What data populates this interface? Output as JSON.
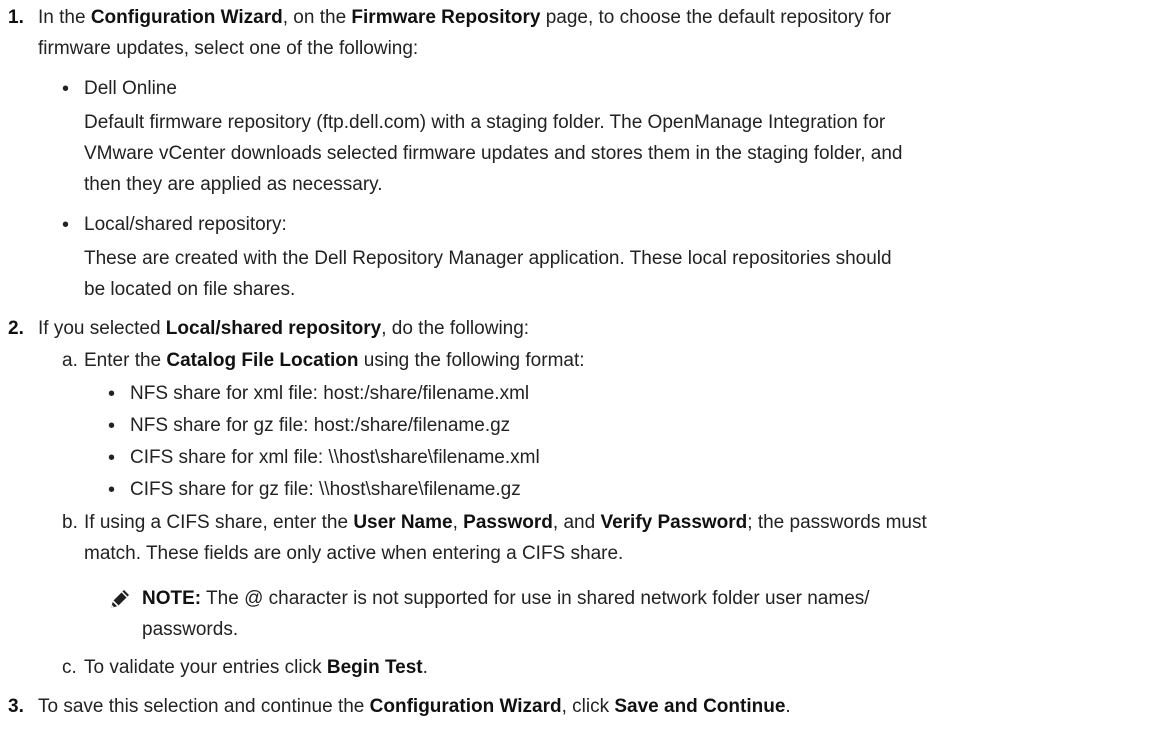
{
  "steps": [
    {
      "number": "1.",
      "text": {
        "p1": "In the ",
        "b1": "Configuration Wizard",
        "p2": ", on the ",
        "b2": "Firmware Repository",
        "p3": " page, to choose the default repository for",
        "line2": "firmware updates, select one of the following:"
      },
      "options": [
        {
          "bullet": "•",
          "title": "Dell Online",
          "desc_lines": [
            "Default firmware repository (ftp.dell.com) with a staging folder. The OpenManage Integration for",
            "VMware vCenter downloads selected firmware updates and stores them in the staging folder, and",
            "then they are applied as necessary."
          ]
        },
        {
          "bullet": "•",
          "title": "Local/shared repository:",
          "desc_lines": [
            "These are created with the Dell Repository Manager application. These local repositories should",
            "be located on file shares."
          ]
        }
      ]
    },
    {
      "number": "2.",
      "text": {
        "p1": "If you selected ",
        "b1": "Local/shared repository",
        "p2": ", do the following:"
      },
      "substeps": {
        "a": {
          "label": "a.",
          "p1": "Enter the ",
          "b1": "Catalog File Location",
          "p2": " using the following format:",
          "bullet": "•",
          "formats": [
            "NFS share for xml file: host:/share/filename.xml",
            "NFS share for gz file: host:/share/filename.gz",
            "CIFS share for xml file: \\\\host\\share\\filename.xml",
            "CIFS share for gz file: \\\\host\\share\\filename.gz"
          ]
        },
        "b": {
          "label": "b.",
          "p1": "If using a CIFS share, enter the ",
          "b1": "User Name",
          "p2": ", ",
          "b2": "Password",
          "p3": ", and ",
          "b3": "Verify Password",
          "p4": "; the passwords must",
          "line2": "match. These fields are only active when entering a CIFS share."
        },
        "note": {
          "label": "NOTE:",
          "p1": " The @ character is not supported for use in shared network folder user names/",
          "line2": "passwords."
        },
        "c": {
          "label": "c.",
          "p1": "To validate your entries click ",
          "b1": "Begin Test",
          "p2": "."
        }
      }
    },
    {
      "number": "3.",
      "text": {
        "p1": "To save this selection and continue the ",
        "b1": "Configuration Wizard",
        "p2": ", click ",
        "b2": "Save and Continue",
        "p3": "."
      }
    }
  ]
}
